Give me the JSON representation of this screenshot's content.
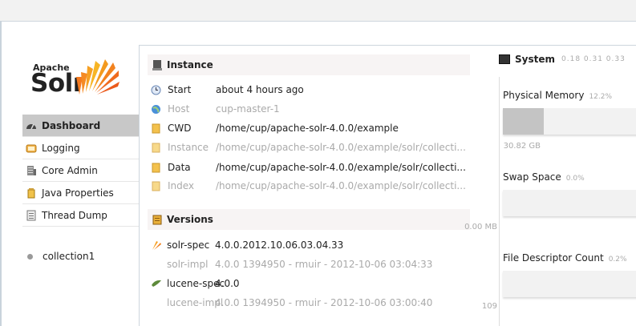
{
  "logo": {
    "apache": "Apache",
    "solr": "Solr"
  },
  "nav": {
    "items": [
      {
        "label": "Dashboard",
        "active": true
      },
      {
        "label": "Logging",
        "active": false
      },
      {
        "label": "Core Admin",
        "active": false
      },
      {
        "label": "Java Properties",
        "active": false
      },
      {
        "label": "Thread Dump",
        "active": false
      }
    ],
    "core": "collection1"
  },
  "instance": {
    "title": "Instance",
    "rows": [
      {
        "key": "Start",
        "value": "about 4 hours ago"
      },
      {
        "key": "Host",
        "value": "cup-master-1"
      },
      {
        "key": "CWD",
        "value": "/home/cup/apache-solr-4.0.0/example"
      },
      {
        "key": "Instance",
        "value": "/home/cup/apache-solr-4.0.0/example/solr/collecti..."
      },
      {
        "key": "Data",
        "value": "/home/cup/apache-solr-4.0.0/example/solr/collecti..."
      },
      {
        "key": "Index",
        "value": "/home/cup/apache-solr-4.0.0/example/solr/collecti..."
      }
    ]
  },
  "versions": {
    "title": "Versions",
    "rows": [
      {
        "key": "solr-spec",
        "value": "4.0.0.2012.10.06.03.04.33"
      },
      {
        "key": "solr-impl",
        "value": "4.0.0 1394950 - rmuir - 2012-10-06 03:04:33"
      },
      {
        "key": "lucene-spec",
        "value": "4.0.0"
      },
      {
        "key": "lucene-impl",
        "value": "4.0.0 1394950 - rmuir - 2012-10-06 03:00:40"
      }
    ]
  },
  "system": {
    "title": "System",
    "load": "0.18  0.31  0.33",
    "physical_memory": {
      "label": "Physical Memory",
      "pct": "12.2%",
      "fraction": 0.3,
      "axis": "30.82 GB"
    },
    "swap_space": {
      "label": "Swap Space",
      "pct": "0.0%",
      "fraction": 0.0,
      "axis": "0.00 MB"
    },
    "file_descriptor": {
      "label": "File Descriptor Count",
      "pct": "0.2%",
      "fraction": 0.0,
      "axis": "109"
    }
  }
}
